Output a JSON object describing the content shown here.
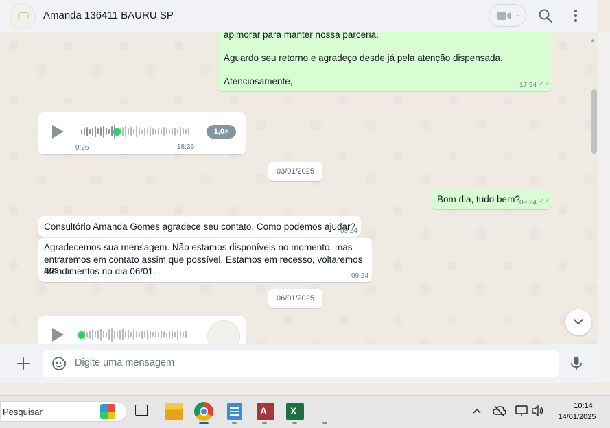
{
  "header": {
    "contact_name": "Amanda 136411 BAURU SP"
  },
  "messages": {
    "top_out": {
      "line_partial": "apimorar para manter nossa parceria.",
      "line1": "Aguardo seu retorno e agradeço desde já pela atenção dispensada.",
      "line2": "Atenciosamente,",
      "time": "17:54"
    },
    "audio1": {
      "elapsed": "0:26",
      "time": "18:36",
      "speed": "1,0×",
      "progress": 0.33
    },
    "date1": "03/01/2025",
    "out_greeting": {
      "text": "Bom dia, tudo bem?",
      "time": "09:24"
    },
    "in_welcome": {
      "text": "Consultório Amanda Gomes agradece seu contato. Como podemos ajudar?",
      "time": "09:24"
    },
    "in_away": {
      "line1": "Agradecemos sua mensagem. Não estamos disponíveis no momento, mas",
      "line2": "entraremos em contato assim que possível. Estamos em recesso, voltaremos aos",
      "line3": "atendimentos no dia 06/01.",
      "time": "09:24"
    },
    "date2": "06/01/2025",
    "audio2": {
      "progress": 0.0
    }
  },
  "composer": {
    "placeholder": "Digite uma mensagem"
  },
  "taskbar": {
    "search_placeholder": "Pesquisar",
    "time": "10:14",
    "date": "14/01/2025",
    "apps": [
      "task-view",
      "file-explorer",
      "chrome",
      "notepad",
      "access",
      "excel"
    ]
  },
  "colors": {
    "outgoing_bubble": "#d9fdd3",
    "incoming_bubble": "#ffffff",
    "chat_background": "#efeae2",
    "accent_green": "#25d366"
  }
}
